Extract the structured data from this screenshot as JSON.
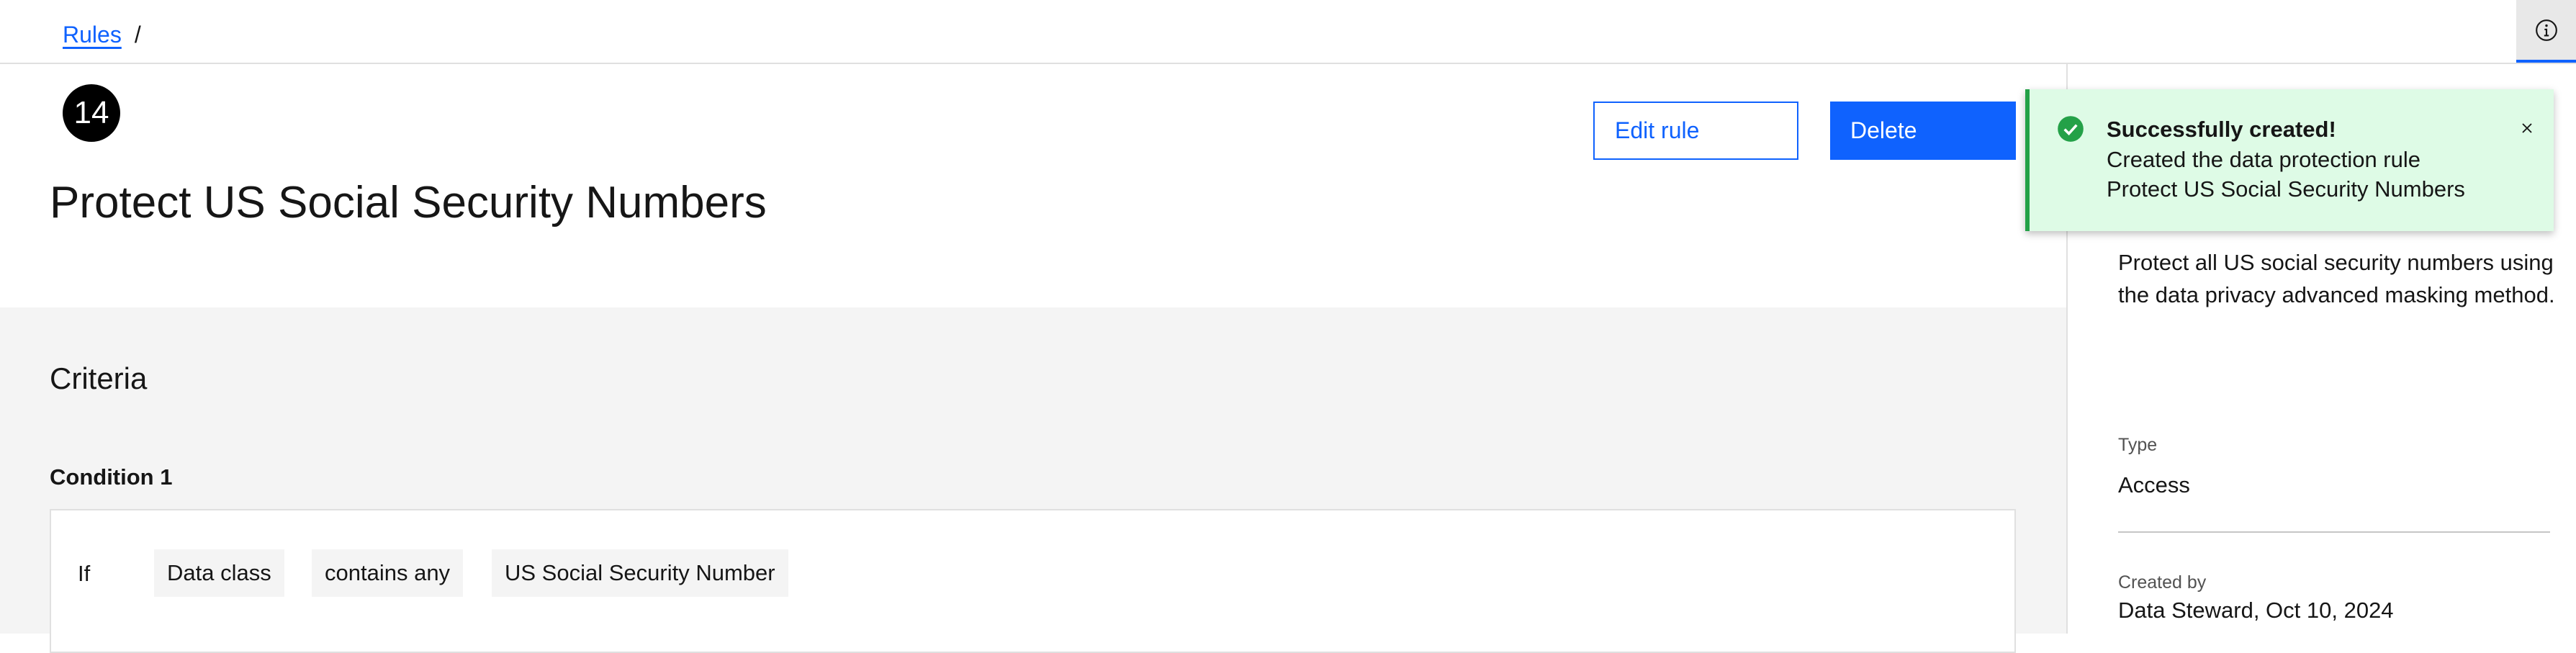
{
  "breadcrumb": {
    "link": "Rules",
    "separator": "/"
  },
  "header": {
    "step_badge": "14",
    "title": "Protect US Social Security Numbers",
    "edit_label": "Edit rule",
    "delete_label": "Delete",
    "info_icon": "info-icon"
  },
  "criteria": {
    "heading": "Criteria",
    "condition_label": "Condition 1",
    "condition": {
      "if_label": "If",
      "tags": [
        "Data class",
        "contains any",
        "US Social Security Number"
      ]
    }
  },
  "details": {
    "description": "Protect all US social security numbers using the data privacy advanced masking method.",
    "type_label": "Type",
    "type_value": "Access",
    "created_by_label": "Created by",
    "created_by_value": "Data Steward, Oct 10, 2024"
  },
  "toast": {
    "title": "Successfully created!",
    "line1": "Created the data protection rule",
    "line2": "Protect US Social Security Numbers",
    "status_color": "#24a148",
    "icon": "checkmark-filled-icon",
    "close_icon": "close-icon"
  },
  "colors": {
    "accent": "#0f62fe",
    "success": "#24a148",
    "success_bg": "#defbe6"
  }
}
